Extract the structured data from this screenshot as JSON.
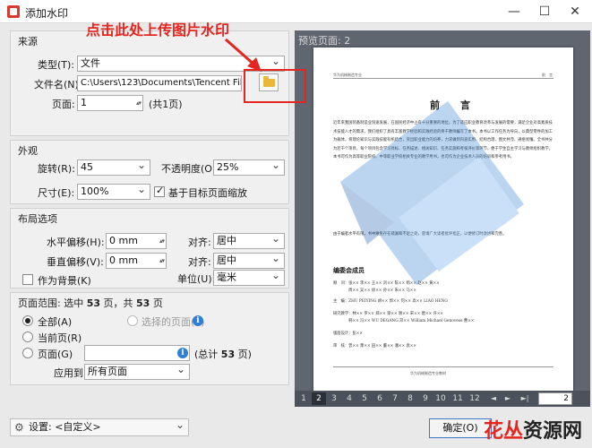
{
  "window": {
    "title": "添加水印",
    "minimize": "—",
    "maximize": "☐",
    "close": "✕"
  },
  "annotation": {
    "text": "点击此处上传图片水印"
  },
  "source": {
    "title": "来源",
    "type_label": "类型(T):",
    "type_value": "文件",
    "filename_label": "文件名(N):",
    "filename_value": "C:\\Users\\123\\Documents\\Tencent Files\\54 8",
    "page_label": "页面:",
    "page_value": "1",
    "page_total": "(共1页)"
  },
  "appearance": {
    "title": "外观",
    "rotation_label": "旋转(R):",
    "rotation_value": "45",
    "opacity_label": "不透明度(O):",
    "opacity_value": "25%",
    "size_label": "尺寸(E):",
    "size_value": "100%",
    "scale_checkbox_label": "基于目标页面缩放",
    "scale_checked": true
  },
  "layout": {
    "title": "布局选项",
    "h_offset_label": "水平偏移(H):",
    "h_offset_value": "0 mm",
    "h_align_label": "对齐:",
    "h_align_value": "居中",
    "v_offset_label": "垂直偏移(V):",
    "v_offset_value": "0 mm",
    "v_align_label": "对齐:",
    "v_align_value": "居中",
    "background_label": "作为背景(K)",
    "background_checked": false,
    "unit_label": "单位(U):",
    "unit_value": "毫米"
  },
  "range": {
    "title_prefix": "页面范围: 选中",
    "selected_count": "53",
    "title_mid": "页，共",
    "total_count": "53",
    "title_suffix": "页",
    "all_label": "全部(A)",
    "selected_pages_label": "选择的页面(S)",
    "current_label": "当前页(R)",
    "pages_label": "页面(G)",
    "pages_value": "",
    "pages_total_prefix": "(总计",
    "pages_total_count": "53",
    "pages_total_suffix": "页)",
    "apply_label": "应用到:",
    "apply_value": "所有页面"
  },
  "preview": {
    "label": "预览页面: 2",
    "header_left": "华为机械制造专业",
    "header_right": "前　言",
    "title": "前　言",
    "para1": "近年来我国装备制造业快速发展，在国民经济中占有十分重要的地位。为了适应职业教育改革与发展的需要，满足企业对高素质技术技能人才的需求，我们组织了具有丰富教学经验和实践经验的骨干教师编写了本书。本书以工作任务为导向，以典型零件的加工为载体，将理论知识与实践技能有机结合，突出职业能力的培养，力求做到内容实用、结构合理、图文并茂、通俗易懂。全书共分为若干个项目，每个项目包含学习目标、任务描述、相关知识、任务实施和考核评价等环节，便于学生自主学习与教师组织教学。本书可作为高等职业院校、中等职业学校相关专业的教学用书，也可作为企业技术人员的培训和参考用书。",
    "para2": "由于编者水平有限，书中难免存在疏漏和不足之处，恳请广大读者批评指正，以便修订时改进和完善。",
    "members_title": "编委会成员",
    "member_rows": [
      "顾　问：张×× 李×× 王×× 刘×× 陈×× 杨×× 赵×× 黄××",
      "　　　　周×× 吴×× 徐×× 孙×× 朱×× 马××",
      "主　编：ZHU PEIYING 胡×× 郭×× 何×× 高×× LIAO HENG",
      "研究教学：林×× 罗×× 郑×× 梁×× 谢×× 宋×× 唐×× 许××",
      "　　　　韩×× 冯×× WU DEGANG 邓×× William Michael Genovese 曹××",
      "版面设计：彭××",
      "审　核：曾×× 萧×× 田×× 董×× 潘×× 袁××"
    ],
    "footer": "华为机械制造专业教材"
  },
  "pager": {
    "pages": [
      "1",
      "2",
      "3",
      "4",
      "5",
      "6",
      "7",
      "8",
      "9",
      "10",
      "11",
      "12"
    ],
    "current": "2",
    "prev_icon": "◄",
    "next_icon": "►",
    "last_icon": "►|",
    "page_input": "2"
  },
  "footer": {
    "settings_label": "设置: <自定义>",
    "ok_label": "确定(O)",
    "brand_part1": "花丛",
    "brand_part2": "资源网"
  },
  "colors": {
    "annotation": "#e52520",
    "watermark": "#2f7fd6",
    "preview_bg": "#5f6670"
  }
}
